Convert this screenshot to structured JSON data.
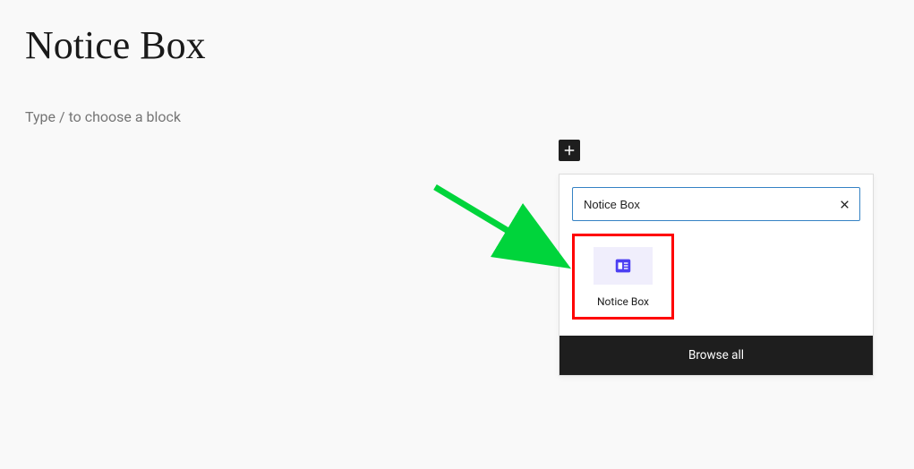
{
  "page": {
    "title": "Notice Box",
    "placeholder": "Type / to choose a block"
  },
  "inserter": {
    "search_value": "Notice Box",
    "browse_all": "Browse all",
    "results": [
      {
        "label": "Notice Box"
      }
    ]
  }
}
